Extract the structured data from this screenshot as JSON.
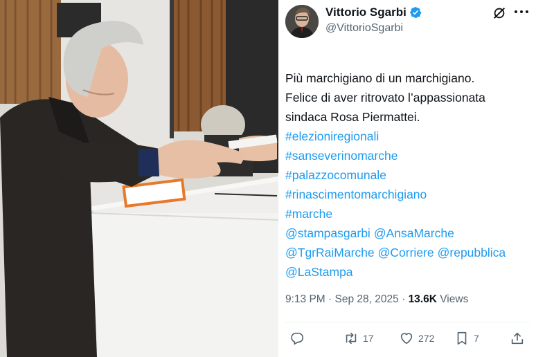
{
  "tweet": {
    "display_name": "Vittorio Sgarbi",
    "handle": "@VittorioSgarbi",
    "text_lines": [
      "Più marchigiano di un marchigiano.",
      "Felice di aver ritrovato l’appassionata",
      "sindaca Rosa Piermattei."
    ],
    "hashtags": [
      "#elezioniregionali",
      "#sanseverinomarche",
      "#palazzocomunale",
      "#rinascimentomarchigiano",
      "#marche"
    ],
    "mentions_line1": [
      "@stampasgarbi",
      "@AnsaMarche"
    ],
    "mentions_line2": [
      "@TgrRaiMarche",
      "@Corriere",
      "@repubblica"
    ],
    "mentions_line3": [
      "@LaStampa"
    ],
    "time": "9:13 PM",
    "separator": "·",
    "date": "Sep 28, 2025",
    "views_count": "13.6K",
    "views_label": "Views",
    "retweets": "17",
    "likes": "272",
    "bookmarks": "7"
  },
  "icons": {
    "verified": "verified-badge-icon",
    "grok": "grok-icon",
    "more": "more-dots-icon",
    "reply": "reply-icon",
    "retweet": "retweet-icon",
    "like": "heart-icon",
    "bookmark": "bookmark-icon",
    "share": "share-icon"
  },
  "colors": {
    "link": "#1d9bf0",
    "text": "#0f1419",
    "secondary": "#536471",
    "verified": "#1d9bf0"
  }
}
